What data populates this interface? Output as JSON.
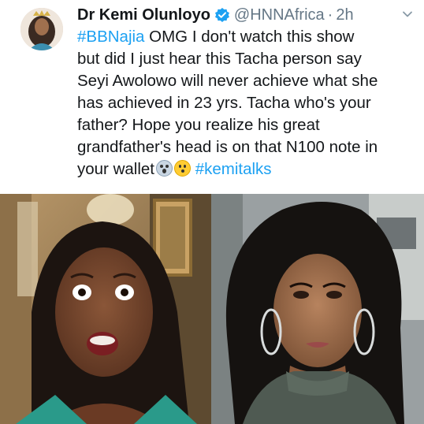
{
  "tweet": {
    "display_name": "Dr Kemi Olunloyo",
    "handle": "@HNNAfrica",
    "separator": "·",
    "time": "2h",
    "body": {
      "line1_hashtag": "#BBNajia",
      "line1_text": " OMG I don't watch this show",
      "line2": "but did I just hear this Tacha  person say",
      "line3": "Seyi Awolowo will never achieve what she",
      "line4": "has achieved in 23 yrs. Tacha who's your",
      "line5": "father? Hope you realize his great",
      "line6": "grandfather's head is on that N100 note in",
      "line7_text": "your wallet",
      "line7_hashtag": "#kemitalks"
    },
    "emojis": [
      "face-screaming-in-fear-icon",
      "hushed-face-icon"
    ],
    "colors": {
      "hashtag": "#1da1f2",
      "verified": "#1da1f2",
      "text": "#14171a",
      "muted": "#657786"
    }
  }
}
